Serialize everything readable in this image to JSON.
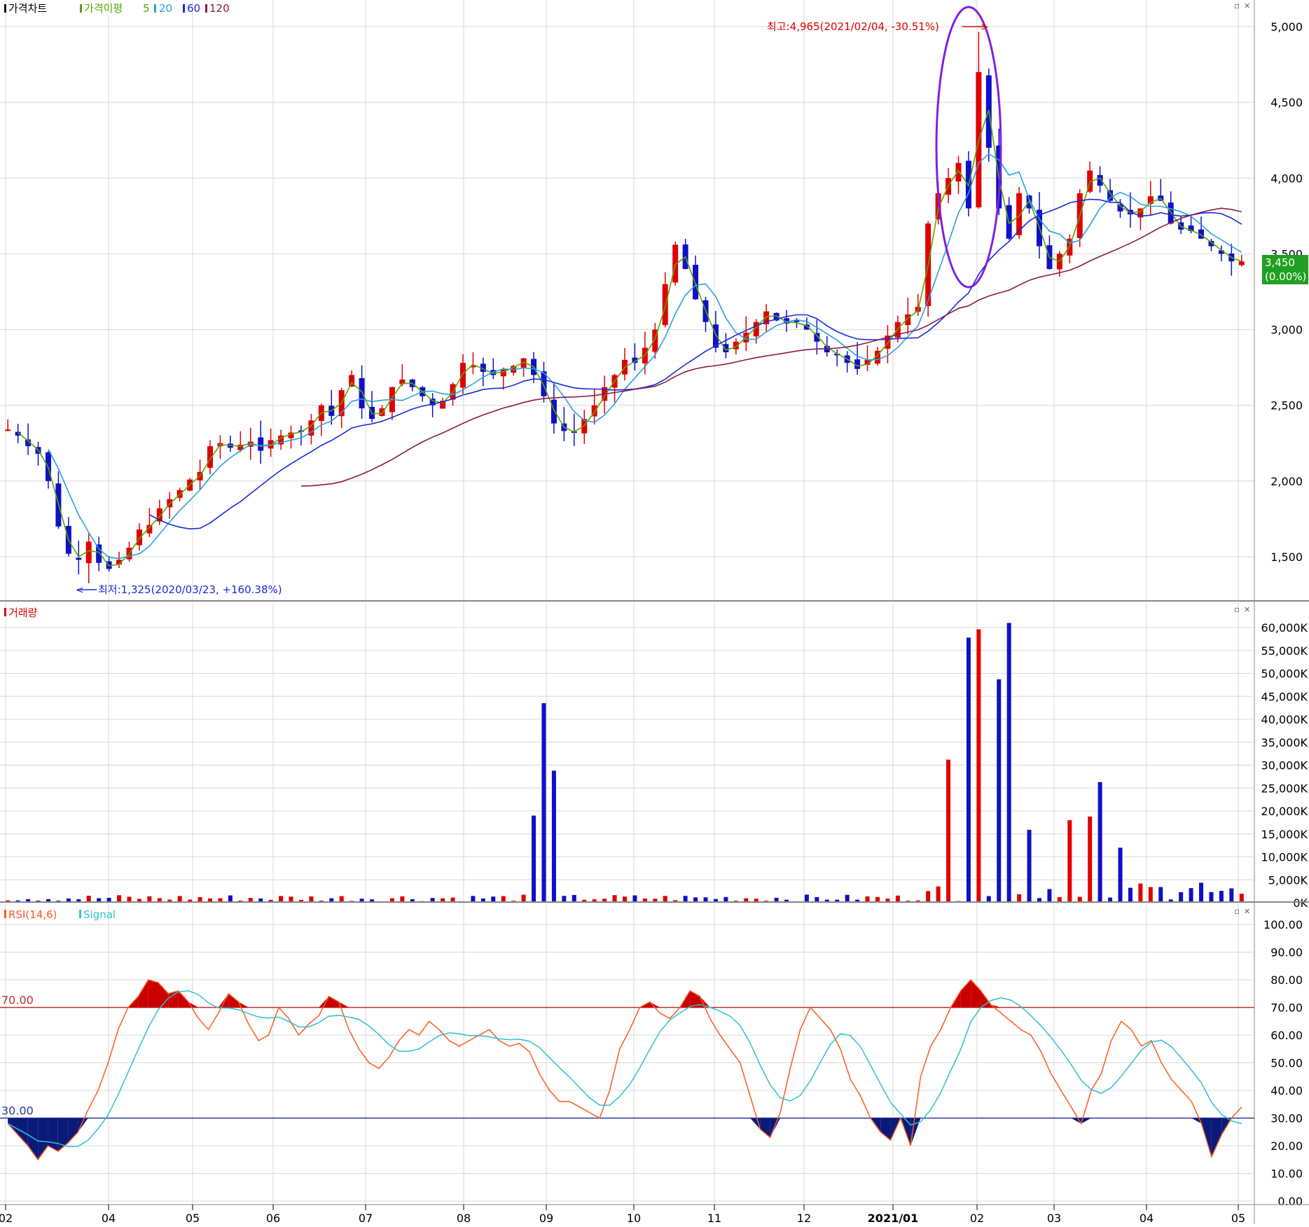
{
  "colors": {
    "up": "#e00000",
    "down": "#1010c8",
    "ma5": "#5aa600",
    "ma20": "#2aa0e0",
    "ma60": "#1a2ad8",
    "ma120": "#8a1a4a",
    "rsi": "#ff5a1e",
    "signal": "#30c0d0",
    "grid": "#d8d8d8",
    "accent_box": "#20a020",
    "circle": "#8020e0"
  },
  "legend": {
    "price_panel": "가격차트",
    "ma_label": "가격이평",
    "ma5": "5",
    "ma20": "20",
    "ma60": "60",
    "ma120": "120",
    "volume_panel": "거래량",
    "rsi_panel": "RSI(14,6)",
    "signal": "Signal"
  },
  "annotations": {
    "high": "최고:4,965(2021/02/04, -30.51%)",
    "low": "최저:1,325(2020/03/23, +160.38%)",
    "last_price": "3,450",
    "last_change": "(0.00%)"
  },
  "window_buttons": {
    "minimize": "▫",
    "close": "✕"
  },
  "chart_data": [
    {
      "type": "candlestick",
      "panel": "price",
      "ylim": [
        1300,
        5100
      ],
      "ytick_labels": [
        "5,000",
        "4,500",
        "4,000",
        "3,500",
        "3,000",
        "2,500",
        "2,000",
        "1,500"
      ],
      "yticks": [
        5000,
        4500,
        4000,
        3500,
        3000,
        2500,
        2000,
        1500
      ],
      "x_ticks": [
        "02",
        "04",
        "05",
        "06",
        "07",
        "08",
        "09",
        "10",
        "11",
        "12",
        "2021/01",
        "02",
        "03",
        "04",
        "05"
      ],
      "close_series": [
        2340,
        2300,
        2230,
        2180,
        2000,
        1700,
        1520,
        1480,
        1600,
        1460,
        1420,
        1480,
        1560,
        1680,
        1710,
        1820,
        1880,
        1940,
        2010,
        2060,
        2230,
        2250,
        2220,
        2240,
        2260,
        2200,
        2270,
        2300,
        2320,
        2330,
        2400,
        2500,
        2430,
        2600,
        2700,
        2480,
        2410,
        2480,
        2620,
        2670,
        2620,
        2560,
        2500,
        2530,
        2640,
        2780,
        2760,
        2720,
        2700,
        2740,
        2760,
        2810,
        2700,
        2560,
        2380,
        2330,
        2320,
        2410,
        2500,
        2620,
        2700,
        2800,
        2780,
        2880,
        3000,
        3300,
        3560,
        3400,
        3200,
        3050,
        2880,
        2850,
        2920,
        2980,
        3050,
        3120,
        3060,
        3040,
        3050,
        3000,
        2920,
        2850,
        2830,
        2780,
        2740,
        2800,
        2860,
        2960,
        3050,
        3100,
        3150,
        3700,
        3900,
        4000,
        4100,
        3800,
        4700,
        4200,
        3800,
        3600,
        3900,
        3800,
        3550,
        3400,
        3500,
        3600,
        3900,
        4050,
        3950,
        3850,
        3780,
        3760,
        3800,
        3880,
        3850,
        3700,
        3660,
        3650,
        3600,
        3550,
        3500,
        3450,
        3450
      ],
      "high": 4965,
      "low": 1325,
      "last": 3450
    },
    {
      "type": "bar",
      "panel": "volume",
      "ylim": [
        0,
        63000
      ],
      "ytick_labels": [
        "60,000K",
        "55,000K",
        "50,000K",
        "45,000K",
        "40,000K",
        "35,000K",
        "30,000K",
        "25,000K",
        "20,000K",
        "15,000K",
        "10,000K",
        "5,000K",
        "0K"
      ],
      "yticks": [
        60000,
        55000,
        50000,
        45000,
        40000,
        35000,
        30000,
        25000,
        20000,
        15000,
        10000,
        5000,
        0
      ],
      "spikes_k": {
        "2020-10-01": 43500,
        "2020-10-02": 28800,
        "2020-09-28": 19000,
        "2021-01-25": 31200,
        "2021-01-28": 57800,
        "2021-01-29": 59600,
        "2021-02-03": 48700,
        "2021-02-04": 61000,
        "2021-02-08": 15900,
        "2021-03-02": 26300
      }
    },
    {
      "type": "line",
      "panel": "rsi",
      "series": [
        {
          "name": "RSI(14,6)"
        },
        {
          "name": "Signal"
        }
      ],
      "ylim": [
        0,
        100
      ],
      "ytick_labels": [
        "100.00",
        "90.00",
        "80.00",
        "70.00",
        "60.00",
        "50.00",
        "40.00",
        "30.00",
        "20.00",
        "10.00",
        "0.00"
      ],
      "yticks": [
        100,
        90,
        80,
        70,
        60,
        50,
        40,
        30,
        20,
        10,
        0
      ],
      "levels": [
        {
          "label": "70.00",
          "value": 70
        },
        {
          "label": "30.00",
          "value": 30
        }
      ],
      "rsi_series": [
        28,
        24,
        20,
        15,
        20,
        18,
        21,
        25,
        33,
        40,
        50,
        62,
        70,
        74,
        80,
        79,
        75,
        76,
        72,
        66,
        62,
        68,
        75,
        72,
        64,
        58,
        60,
        70,
        66,
        60,
        64,
        67,
        74,
        72,
        62,
        55,
        50,
        48,
        52,
        58,
        62,
        60,
        65,
        62,
        58,
        56,
        58,
        60,
        62,
        58,
        56,
        57,
        54,
        46,
        40,
        36,
        36,
        34,
        32,
        30,
        40,
        55,
        62,
        70,
        72,
        68,
        66,
        70,
        76,
        74,
        66,
        60,
        55,
        50,
        38,
        26,
        23,
        32,
        48,
        62,
        70,
        66,
        62,
        55,
        44,
        38,
        30,
        25,
        22,
        30,
        20,
        45,
        56,
        62,
        70,
        76,
        80,
        76,
        71,
        68,
        65,
        62,
        60,
        54,
        46,
        40,
        34,
        28,
        40,
        46,
        58,
        65,
        62,
        56,
        58,
        50,
        44,
        40,
        36,
        28,
        16,
        24,
        30,
        34
      ]
    }
  ]
}
